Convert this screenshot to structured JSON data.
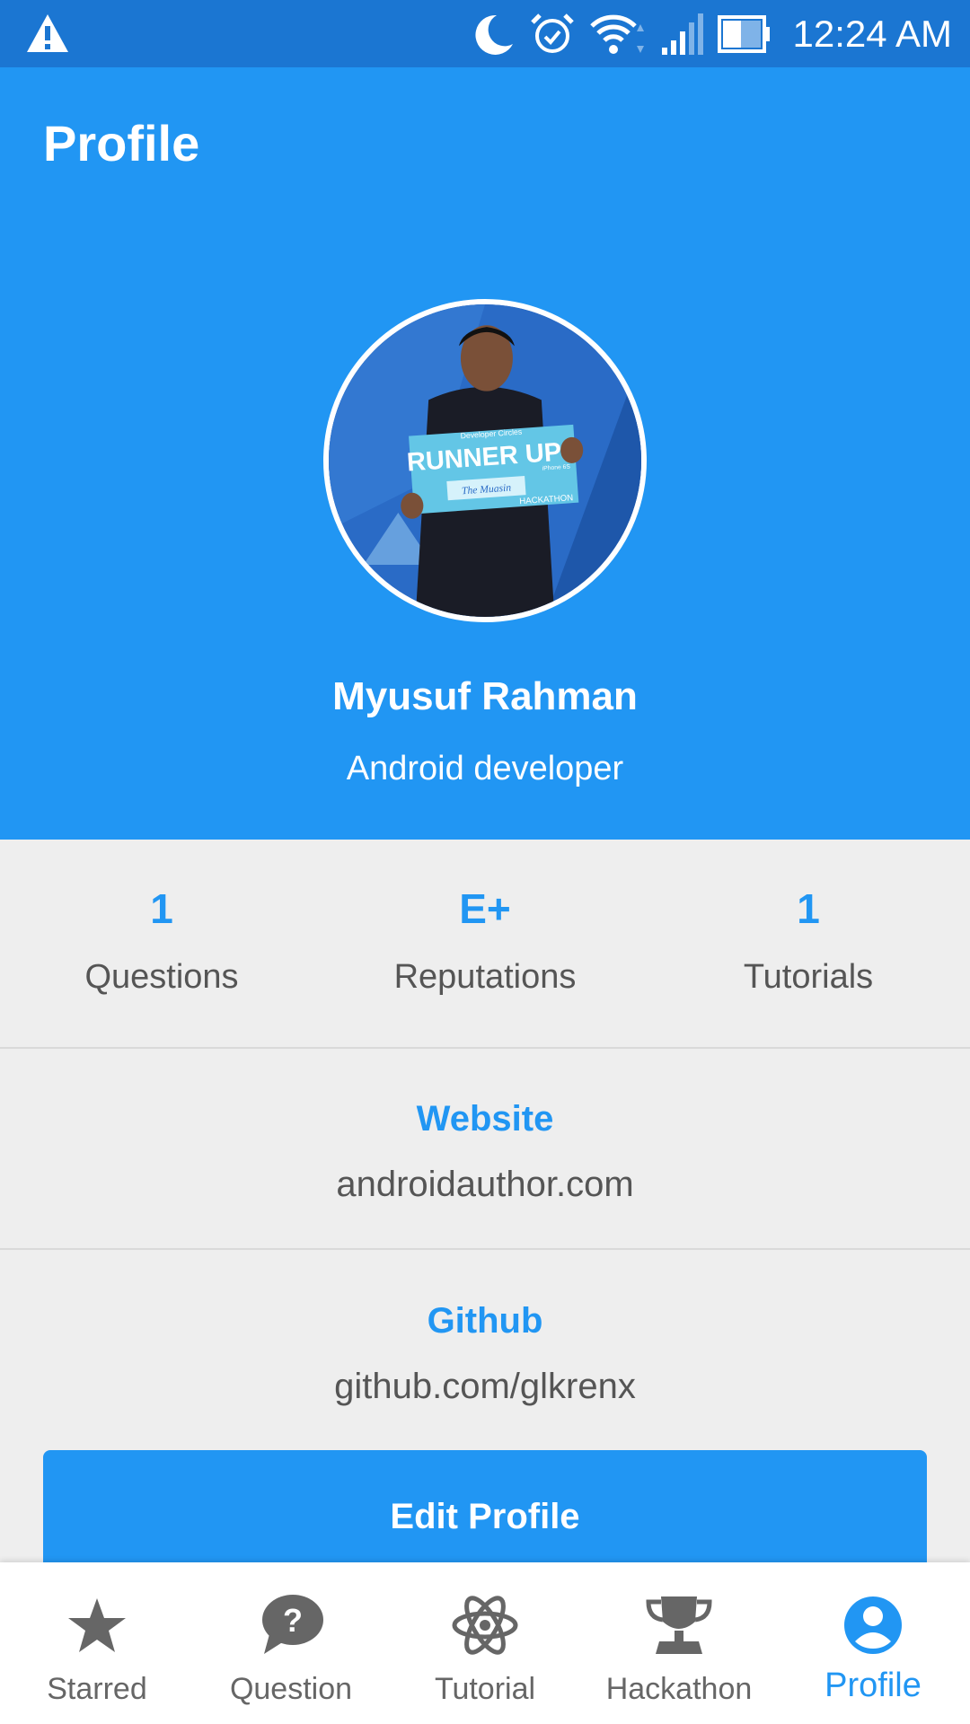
{
  "status_bar": {
    "time": "12:24 AM",
    "icons": [
      "warning-icon",
      "moon-icon",
      "alarm-icon",
      "wifi-icon",
      "signal-icon",
      "battery-icon"
    ]
  },
  "header": {
    "title": "Profile",
    "name": "Myusuf Rahman",
    "role": "Android developer",
    "avatar_sign": {
      "top": "Developer Circles",
      "main": "RUNNER UP",
      "sub": "iPhone 6S",
      "handwritten": "The Muasin",
      "bottom": "HACKATHON"
    }
  },
  "stats": [
    {
      "value": "1",
      "label": "Questions"
    },
    {
      "value": "E+",
      "label": "Reputations"
    },
    {
      "value": "1",
      "label": "Tutorials"
    }
  ],
  "website": {
    "label": "Website",
    "value": "androidauthor.com"
  },
  "github": {
    "label": "Github",
    "value": "github.com/glkrenx"
  },
  "edit_button": "Edit Profile",
  "bottom_nav": [
    {
      "label": "Starred",
      "icon": "star-icon"
    },
    {
      "label": "Question",
      "icon": "question-bubble-icon"
    },
    {
      "label": "Tutorial",
      "icon": "atom-icon"
    },
    {
      "label": "Hackathon",
      "icon": "trophy-icon"
    },
    {
      "label": "Profile",
      "icon": "account-circle-icon",
      "active": true
    }
  ],
  "colors": {
    "primary": "#2196f3",
    "status_bar": "#1b76d2",
    "background": "#eeeeee"
  }
}
